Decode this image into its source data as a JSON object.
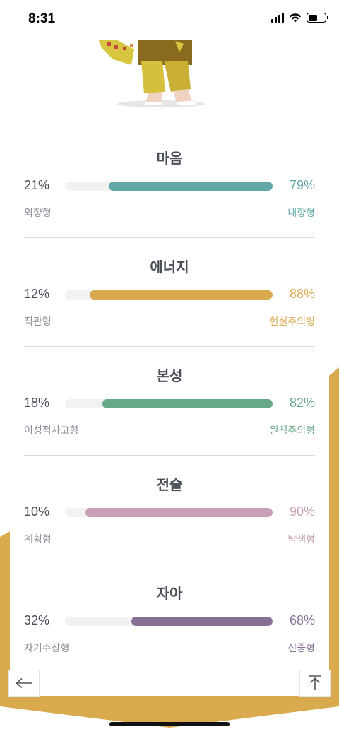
{
  "status_bar": {
    "time": "8:31"
  },
  "colors": {
    "gold": "#d9aa4e",
    "text_dark": "#4a4e57",
    "text_muted": "#8a8e96"
  },
  "sections": [
    {
      "title": "마음",
      "left_pct": "21%",
      "right_pct": "79%",
      "left_label": "외향형",
      "right_label": "내향형",
      "fill_fraction": 0.79,
      "color": "#62a8a8"
    },
    {
      "title": "에너지",
      "left_pct": "12%",
      "right_pct": "88%",
      "left_label": "직관형",
      "right_label": "현실주의형",
      "fill_fraction": 0.88,
      "color": "#d8a94e"
    },
    {
      "title": "본성",
      "left_pct": "18%",
      "right_pct": "82%",
      "left_label": "이성적사고형",
      "right_label": "원칙주의형",
      "fill_fraction": 0.82,
      "color": "#66a888"
    },
    {
      "title": "전술",
      "left_pct": "10%",
      "right_pct": "90%",
      "left_label": "계획형",
      "right_label": "탐색형",
      "fill_fraction": 0.9,
      "color": "#c99fb5"
    },
    {
      "title": "자아",
      "left_pct": "32%",
      "right_pct": "68%",
      "left_label": "자기주장형",
      "right_label": "신중형",
      "fill_fraction": 0.68,
      "color": "#876f96"
    }
  ],
  "nav": {
    "back_icon": "arrow-left-icon",
    "top_icon": "arrow-up-to-top-icon"
  }
}
